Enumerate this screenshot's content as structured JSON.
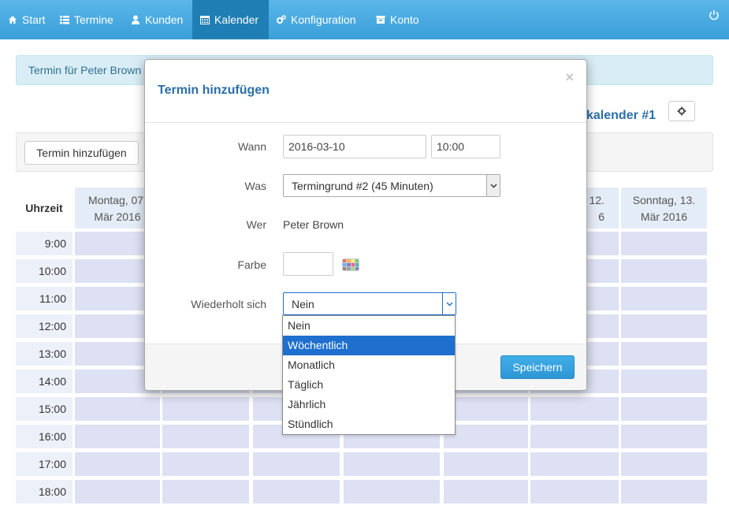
{
  "nav": {
    "items": [
      {
        "label": "Start",
        "icon": "home-icon"
      },
      {
        "label": "Termine",
        "icon": "list-icon"
      },
      {
        "label": "Kunden",
        "icon": "user-icon"
      },
      {
        "label": "Kalender",
        "icon": "calendar-icon",
        "active": true
      },
      {
        "label": "Konfiguration",
        "icon": "gears-icon"
      },
      {
        "label": "Konto",
        "icon": "inbox-icon"
      }
    ]
  },
  "alert": {
    "text": "Termin für Peter Brown"
  },
  "calendar": {
    "title": "kalender #1",
    "add_button": "Termin hinzufügen",
    "time_header": "Uhrzeit",
    "days": [
      {
        "line1": "Montag, 07.",
        "line2": "Mär 2016"
      },
      {
        "line1": "12.",
        "line2": "6"
      },
      {
        "line1": "Sonntag, 13.",
        "line2": "Mär 2016"
      }
    ],
    "times": [
      "9:00",
      "10:00",
      "11:00",
      "12:00",
      "13:00",
      "14:00",
      "15:00",
      "16:00",
      "17:00",
      "18:00"
    ]
  },
  "modal": {
    "title": "Termin hinzufügen",
    "close": "×",
    "labels": {
      "wann": "Wann",
      "was": "Was",
      "wer": "Wer",
      "farbe": "Farbe",
      "wiederholt": "Wiederholt sich"
    },
    "date_value": "2016-03-10",
    "time_value": "10:00",
    "was_value": "Termingrund #2 (45 Minuten)",
    "wer_value": "Peter Brown",
    "repeat_value": "Nein",
    "save": "Speichern"
  },
  "dropdown": {
    "options": [
      "Nein",
      "Wöchentlich",
      "Monatlich",
      "Täglich",
      "Jährlich",
      "Stündlich"
    ],
    "highlighted": "Wöchentlich"
  },
  "colors": {
    "nav": "#3a9fd9",
    "nav_active": "#1f7fb5",
    "slot": "#dde1f3",
    "header_bg": "#e4ecf7",
    "primary": "#2a9fd6",
    "dropdown_highlight": "#1e6fce"
  }
}
